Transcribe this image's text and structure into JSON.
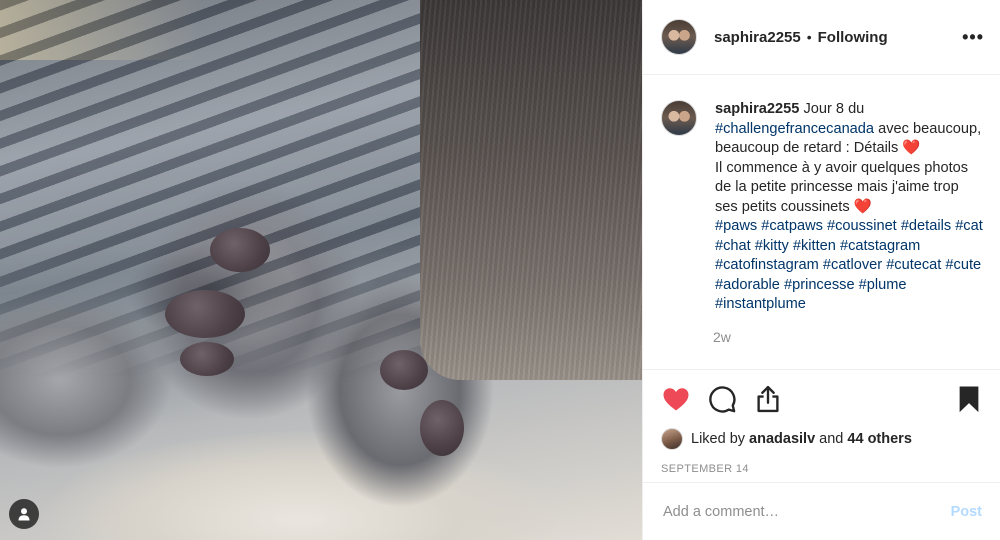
{
  "header": {
    "username": "saphira2255",
    "separator": "•",
    "follow_status": "Following",
    "more_icon": "more-horizontal-icon"
  },
  "caption": {
    "username": "saphira2255",
    "line1": "Jour 8 du",
    "hashtag_main": "#challengefrancecanada",
    "line2": "avec beaucoup, beaucoup de retard : Détails",
    "heart1": "❤️",
    "line3": "Il commence à y avoir quelques photos de la petite princesse mais j'aime trop ses petits coussinets",
    "heart2": "❤️",
    "hashtags": [
      "#paws",
      "#catpaws",
      "#coussinet",
      "#details",
      "#cat",
      "#chat",
      "#kitty",
      "#kitten",
      "#catstagram",
      "#catofinstagram",
      "#catlover",
      "#cutecat",
      "#cute",
      "#adorable",
      "#princesse",
      "#plume",
      "#instantplume"
    ],
    "time_ago": "2w"
  },
  "actions": {
    "like_icon": "heart-filled-icon",
    "comment_icon": "comment-bubble-icon",
    "share_icon": "share-icon",
    "save_icon": "bookmark-icon",
    "like_color": "#ed4956"
  },
  "likes": {
    "prefix": "Liked by",
    "user": "anadasilv",
    "conj": "and",
    "others": "44 others"
  },
  "date": "SEPTEMBER 14",
  "comment_box": {
    "placeholder": "Add a comment…",
    "post_label": "Post"
  },
  "colors": {
    "hashtag": "#003569",
    "muted": "#8e8e8e",
    "post_disabled": "#b3dbff"
  }
}
